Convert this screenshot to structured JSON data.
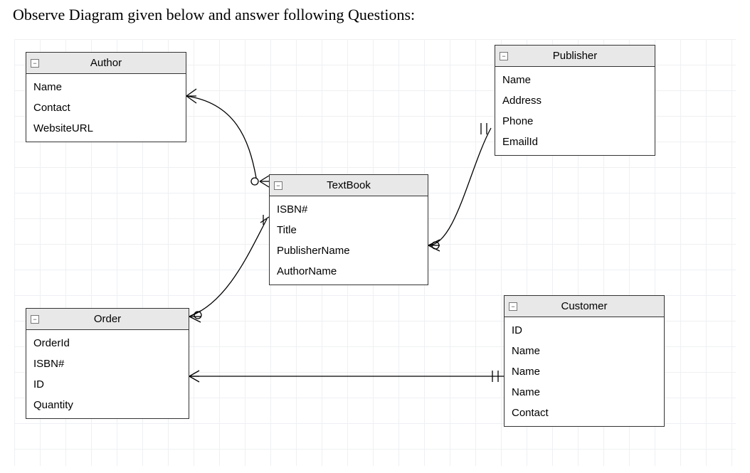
{
  "instruction": "Observe Diagram given below and answer following Questions:",
  "entities": {
    "author": {
      "title": "Author",
      "attrs": [
        "Name",
        "Contact",
        "WebsiteURL"
      ]
    },
    "publisher": {
      "title": "Publisher",
      "attrs": [
        "Name",
        "Address",
        "Phone",
        "EmailId"
      ]
    },
    "textbook": {
      "title": "TextBook",
      "attrs": [
        "ISBN#",
        "Title",
        "PublisherName",
        "AuthorName"
      ]
    },
    "order": {
      "title": "Order",
      "attrs": [
        "OrderId",
        "ISBN#",
        "ID",
        "Quantity"
      ]
    },
    "customer": {
      "title": "Customer",
      "attrs": [
        "ID",
        "Name",
        "Name",
        "Name",
        "Contact"
      ]
    }
  },
  "chart_data": {
    "type": "entity-relationship-diagram",
    "entities": [
      {
        "name": "Author",
        "attributes": [
          "Name",
          "Contact",
          "WebsiteURL"
        ]
      },
      {
        "name": "Publisher",
        "attributes": [
          "Name",
          "Address",
          "Phone",
          "EmailId"
        ]
      },
      {
        "name": "TextBook",
        "attributes": [
          "ISBN#",
          "Title",
          "PublisherName",
          "AuthorName"
        ]
      },
      {
        "name": "Order",
        "attributes": [
          "OrderId",
          "ISBN#",
          "ID",
          "Quantity"
        ]
      },
      {
        "name": "Customer",
        "attributes": [
          "ID",
          "Name",
          "Name",
          "Name",
          "Contact"
        ]
      }
    ],
    "relationships": [
      {
        "from": "Author",
        "to": "TextBook",
        "from_cardinality": "many",
        "to_cardinality": "many"
      },
      {
        "from": "TextBook",
        "to": "Publisher",
        "from_cardinality": "many",
        "to_cardinality": "one"
      },
      {
        "from": "Order",
        "to": "TextBook",
        "from_cardinality": "many",
        "to_cardinality": "one"
      },
      {
        "from": "Order",
        "to": "Customer",
        "from_cardinality": "many",
        "to_cardinality": "one"
      }
    ]
  }
}
